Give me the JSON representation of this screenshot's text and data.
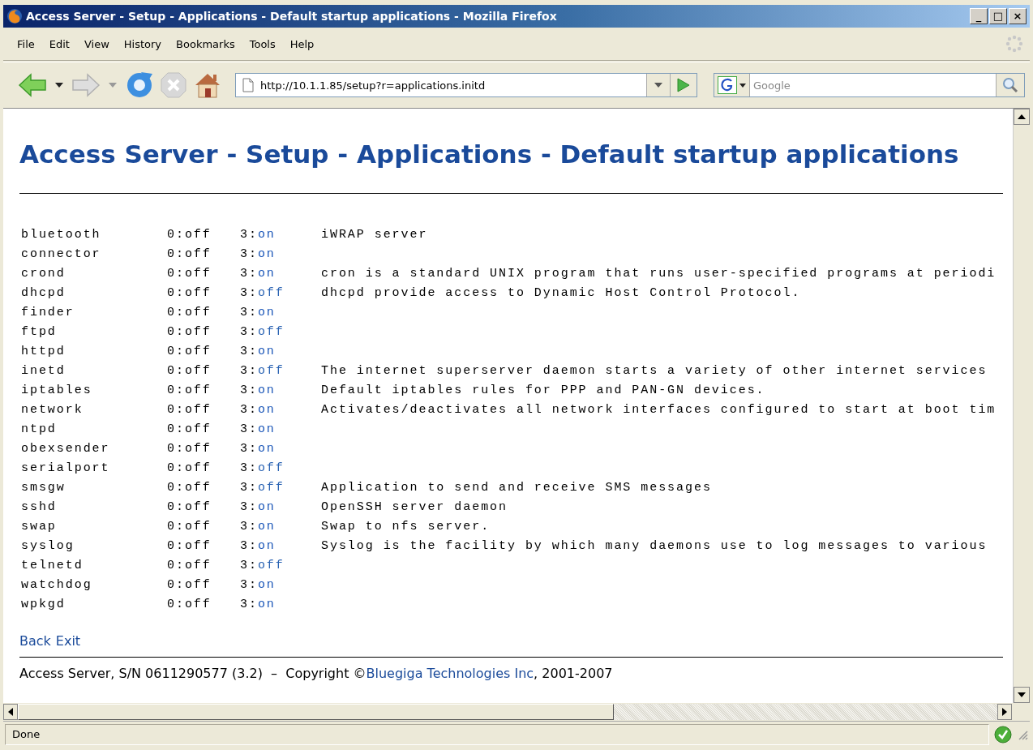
{
  "window": {
    "title": "Access Server - Setup - Applications - Default startup applications - Mozilla Firefox",
    "controls": [
      "_",
      "□",
      "×"
    ]
  },
  "menu": [
    {
      "label": "File"
    },
    {
      "label": "Edit"
    },
    {
      "label": "View"
    },
    {
      "label": "History"
    },
    {
      "label": "Bookmarks"
    },
    {
      "label": "Tools"
    },
    {
      "label": "Help"
    }
  ],
  "toolbar": {
    "address": "http://10.1.1.85/setup?r=applications.initd",
    "search_placeholder": "Google"
  },
  "page": {
    "heading": "Access Server - Setup - Applications - Default startup applications",
    "rows": [
      {
        "name": "bluetooth",
        "runlevel_0": "0:off",
        "runlevel_3": "3:",
        "toggle": "on",
        "description": "iWRAP server"
      },
      {
        "name": "connector",
        "runlevel_0": "0:off",
        "runlevel_3": "3:",
        "toggle": "on"
      },
      {
        "name": "crond",
        "runlevel_0": "0:off",
        "runlevel_3": "3:",
        "toggle": "on",
        "description": "cron is a standard UNIX program that runs user-specified programs at periodi"
      },
      {
        "name": "dhcpd",
        "runlevel_0": "0:off",
        "runlevel_3": "3:",
        "toggle": "off",
        "description": "dhcpd provide access to Dynamic Host Control Protocol."
      },
      {
        "name": "finder",
        "runlevel_0": "0:off",
        "runlevel_3": "3:",
        "toggle": "on"
      },
      {
        "name": "ftpd",
        "runlevel_0": "0:off",
        "runlevel_3": "3:",
        "toggle": "off"
      },
      {
        "name": "httpd",
        "runlevel_0": "0:off",
        "runlevel_3": "3:",
        "toggle": "on"
      },
      {
        "name": "inetd",
        "runlevel_0": "0:off",
        "runlevel_3": "3:",
        "toggle": "off",
        "description": "The internet superserver daemon starts a variety of other internet services"
      },
      {
        "name": "iptables",
        "runlevel_0": "0:off",
        "runlevel_3": "3:",
        "toggle": "on",
        "description": "Default iptables rules for PPP and PAN-GN devices."
      },
      {
        "name": "network",
        "runlevel_0": "0:off",
        "runlevel_3": "3:",
        "toggle": "on",
        "description": "Activates/deactivates all network interfaces configured to start at boot tim"
      },
      {
        "name": "ntpd",
        "runlevel_0": "0:off",
        "runlevel_3": "3:",
        "toggle": "on"
      },
      {
        "name": "obexsender",
        "runlevel_0": "0:off",
        "runlevel_3": "3:",
        "toggle": "on"
      },
      {
        "name": "serialport",
        "runlevel_0": "0:off",
        "runlevel_3": "3:",
        "toggle": "off"
      },
      {
        "name": "smsgw",
        "runlevel_0": "0:off",
        "runlevel_3": "3:",
        "toggle": "off",
        "description": "Application to send and receive SMS messages"
      },
      {
        "name": "sshd",
        "runlevel_0": "0:off",
        "runlevel_3": "3:",
        "toggle": "on",
        "description": "OpenSSH server daemon"
      },
      {
        "name": "swap",
        "runlevel_0": "0:off",
        "runlevel_3": "3:",
        "toggle": "on",
        "description": "Swap to nfs server."
      },
      {
        "name": "syslog",
        "runlevel_0": "0:off",
        "runlevel_3": "3:",
        "toggle": "on",
        "description": "Syslog is the facility by which many daemons use to log messages to various"
      },
      {
        "name": "telnetd",
        "runlevel_0": "0:off",
        "runlevel_3": "3:",
        "toggle": "off"
      },
      {
        "name": "watchdog",
        "runlevel_0": "0:off",
        "runlevel_3": "3:",
        "toggle": "on"
      },
      {
        "name": "wpkgd",
        "runlevel_0": "0:off",
        "runlevel_3": "3:",
        "toggle": "on"
      }
    ],
    "links": [
      "Back",
      "Exit"
    ],
    "footer": {
      "text_before": "Access Server, S/N 0611290577 (3.2)  –  Copyright ©",
      "link": "Bluegiga Technologies Inc",
      "text_after": ", 2001-2007"
    }
  },
  "status_bar": {
    "text": "Done"
  }
}
